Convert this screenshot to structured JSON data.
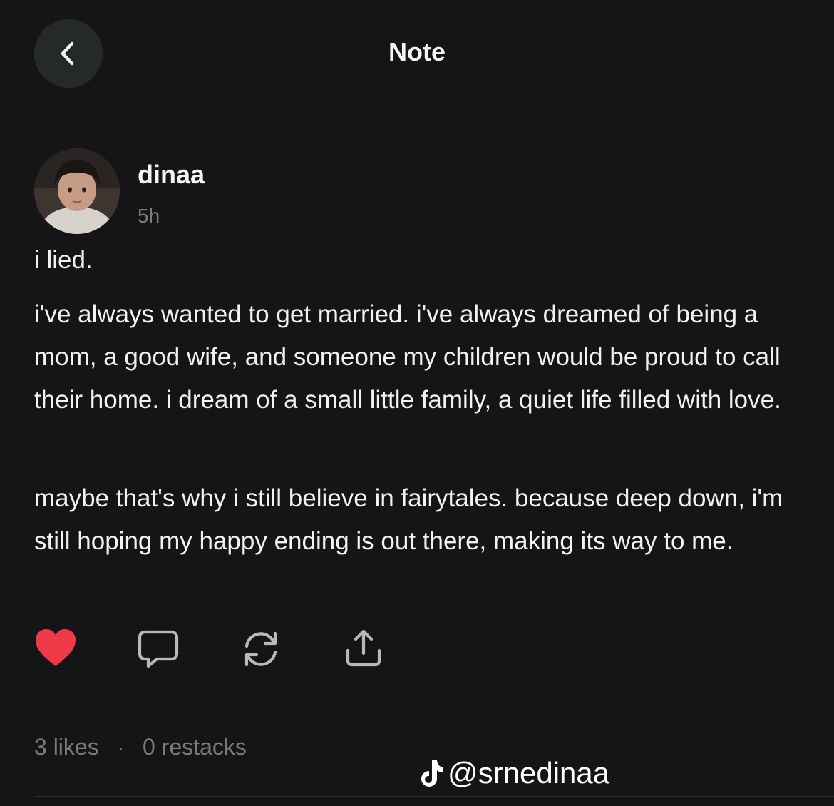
{
  "header": {
    "title": "Note",
    "back_icon": "chevron-left-icon"
  },
  "post": {
    "author": "dinaa",
    "time": "5h",
    "paragraphs": [
      "i lied.",
      "i've always wanted to get married. i've always dreamed of being a mom, a good wife, and someone my children would be proud to call their home. i dream of a small little family, a quiet life filled with love.",
      "maybe that's why i still believe in fairytales. because deep down, i'm still hoping my happy ending is out there, making its way to me."
    ]
  },
  "actions": {
    "like_icon": "heart-filled-icon",
    "comment_icon": "comment-icon",
    "restack_icon": "restack-icon",
    "share_icon": "share-icon",
    "like_color": "#ef3a47"
  },
  "stats": {
    "likes": "3 likes",
    "separator": "·",
    "restacks": "0 restacks"
  },
  "watermark": {
    "icon": "tiktok-icon",
    "handle": "@srnedinaa"
  }
}
